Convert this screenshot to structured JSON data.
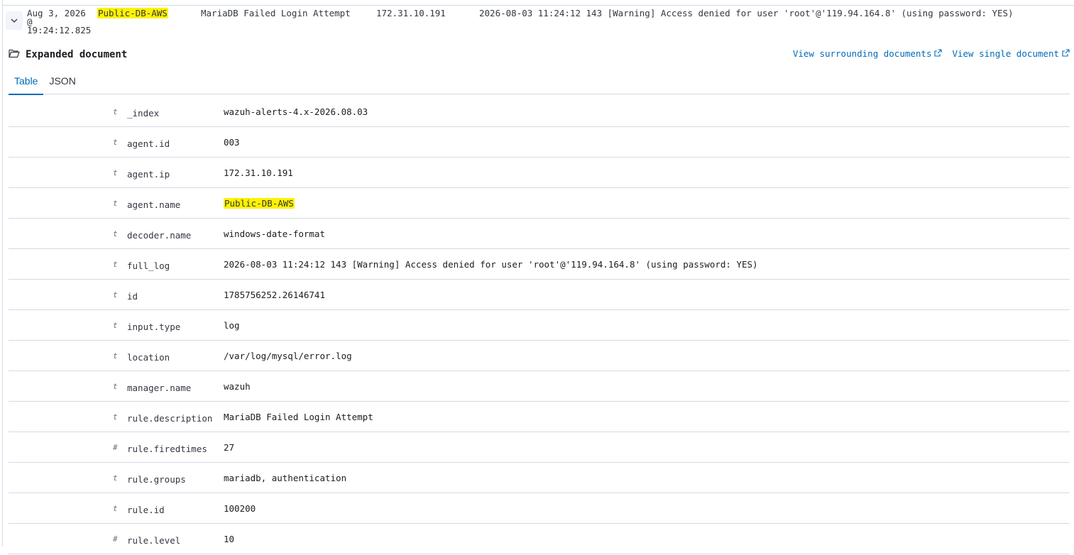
{
  "summary": {
    "date": "Aug 3, 2026 @ 19:24:12.825",
    "agent_name": "Public-DB-AWS",
    "description": "MariaDB Failed Login Attempt",
    "agent_ip": "172.31.10.191",
    "full_log": "2026-08-03 11:24:12 143 [Warning] Access denied for user 'root'@'119.94.164.8' (using password: YES)"
  },
  "header": {
    "title": "Expanded document",
    "surrounding_link": "View surrounding documents",
    "single_link": "View single document"
  },
  "tabs": [
    {
      "label": "Table",
      "active": true
    },
    {
      "label": "JSON",
      "active": false
    }
  ],
  "fields": [
    {
      "type": "t",
      "name": "_index",
      "value": "wazuh-alerts-4.x-2026.08.03"
    },
    {
      "type": "t",
      "name": "agent.id",
      "value": "003"
    },
    {
      "type": "t",
      "name": "agent.ip",
      "value": "172.31.10.191"
    },
    {
      "type": "t",
      "name": "agent.name",
      "value": "Public-DB-AWS",
      "highlight": true
    },
    {
      "type": "t",
      "name": "decoder.name",
      "value": "windows-date-format"
    },
    {
      "type": "t",
      "name": "full_log",
      "value": "2026-08-03 11:24:12 143 [Warning] Access denied for user 'root'@'119.94.164.8' (using password: YES)"
    },
    {
      "type": "t",
      "name": "id",
      "value": "1785756252.26146741"
    },
    {
      "type": "t",
      "name": "input.type",
      "value": "log"
    },
    {
      "type": "t",
      "name": "location",
      "value": "/var/log/mysql/error.log"
    },
    {
      "type": "t",
      "name": "manager.name",
      "value": "wazuh"
    },
    {
      "type": "t",
      "name": "rule.description",
      "value": "MariaDB Failed Login Attempt"
    },
    {
      "type": "#",
      "name": "rule.firedtimes",
      "value": "27"
    },
    {
      "type": "t",
      "name": "rule.groups",
      "value": "mariadb, authentication"
    },
    {
      "type": "t",
      "name": "rule.id",
      "value": "100200"
    },
    {
      "type": "#",
      "name": "rule.level",
      "value": "10"
    }
  ],
  "colors": {
    "accent": "#006bb8",
    "highlight": "#fff200",
    "border": "#d3dae6"
  },
  "icons": {
    "toggle": "chevron-down-icon",
    "folder": "folder-open-icon",
    "external": "external-link-icon"
  }
}
